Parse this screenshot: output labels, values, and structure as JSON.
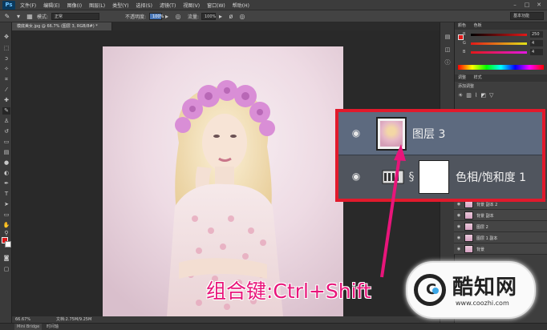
{
  "app": {
    "logo": "Ps"
  },
  "menu": [
    "文件(F)",
    "编辑(E)",
    "图像(I)",
    "图层(L)",
    "类型(Y)",
    "选择(S)",
    "滤镜(T)",
    "视图(V)",
    "窗口(W)",
    "帮助(H)"
  ],
  "window_controls": [
    "–",
    "□",
    "✕"
  ],
  "options": {
    "mode_label": "模式:",
    "mode_value": "正常",
    "opacity_label": "不透明度:",
    "opacity_value": "100%",
    "flow_label": "流量:",
    "flow_value": "100%",
    "workspace": "基本功能"
  },
  "document": {
    "tab_title": "模底美女.jpg @ 66.7% (图层 3, RGB/8#) *",
    "zoom": "66.67%",
    "doc_size": "文档:2.75M/9.25M"
  },
  "bottom_tabs": [
    "Mini Bridge",
    "时间轴"
  ],
  "color_panel": {
    "tabs": [
      "颜色",
      "色板"
    ],
    "sliders": [
      {
        "label": "R",
        "value": "250",
        "color": "#e21818"
      },
      {
        "label": "G",
        "value": "4",
        "color": "#18b818"
      },
      {
        "label": "B",
        "value": "4",
        "color": "#2040e0"
      }
    ]
  },
  "adjust_panel": {
    "tabs": [
      "调整",
      "样式"
    ],
    "title": "添加调整"
  },
  "layers_small": [
    {
      "name": "背景 副本 2"
    },
    {
      "name": "背景 副本"
    },
    {
      "name": "图层 2"
    },
    {
      "name": "图层 1 副本"
    },
    {
      "name": "背景"
    }
  ],
  "callout": {
    "layer_top": "图层 3",
    "layer_bottom": "色相/饱和度 1",
    "border_color": "#e11a2c"
  },
  "annotation": {
    "text": "组合键:Ctrl+Shift",
    "color": "#e8157a"
  },
  "watermark": {
    "name": "酷知网",
    "url": "www.coozhi.com"
  },
  "icons": [
    "brush-icon",
    "move-icon",
    "marquee-icon",
    "lasso-icon",
    "crop-icon",
    "eyedropper-icon",
    "eye-icon",
    "link-icon",
    "hue-saturation-icon"
  ]
}
